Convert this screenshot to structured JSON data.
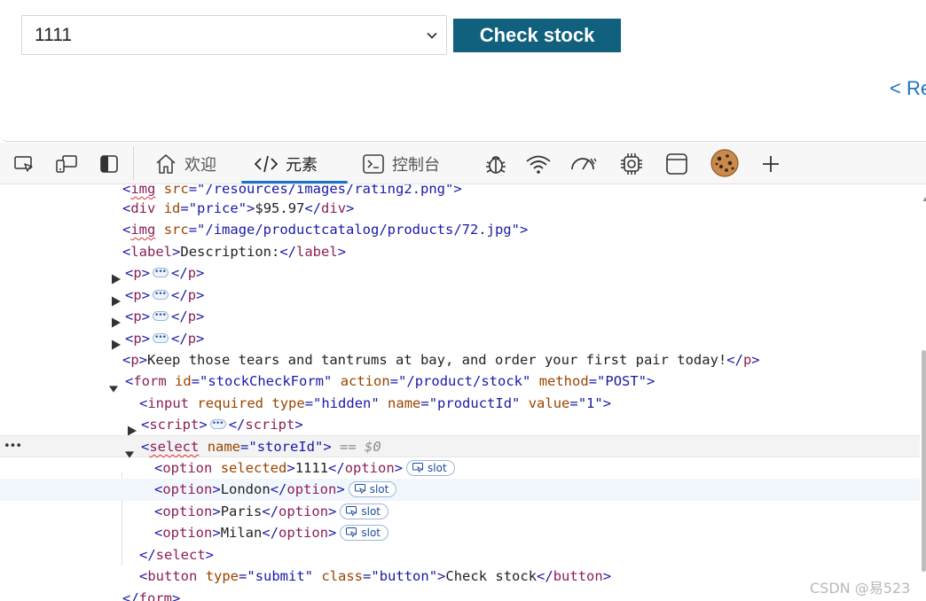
{
  "page": {
    "store_select_value": "1111",
    "check_stock_label": "Check stock",
    "return_link": "< Re"
  },
  "devtools": {
    "tabs": [
      {
        "label": "欢迎",
        "icon": "home-icon"
      },
      {
        "label": "元素",
        "icon": "code-icon"
      },
      {
        "label": "控制台",
        "icon": "console-icon"
      }
    ],
    "accent_color": "#1a73c8",
    "toolbar_icons": [
      "inspect-icon",
      "device-emulation-icon",
      "sidebar-toggle-icon",
      "bug-icon",
      "wifi-icon",
      "performance-gauge-icon",
      "cpu-icon",
      "application-window-icon",
      "cookie-icon",
      "plus-icon"
    ]
  },
  "tree": {
    "r0_attr": "src",
    "r0_val": "\"/resources/images/rating2.png\"",
    "r1_attr": "id",
    "r1_val": "\"price\"",
    "r1_text": "$95.97",
    "r2_attr": "src",
    "r2_val": "\"/image/productcatalog/products/72.jpg\"",
    "r3_text": "Description:",
    "r8_text": "Keep those tears and tantrums at bay, and order your first pair today!",
    "r9_a1": "id",
    "r9_v1": "\"stockCheckForm\"",
    "r9_a2": "action",
    "r9_v2": "\"/product/stock\"",
    "r9_a3": "method",
    "r9_v3": "\"POST\"",
    "r10_a1": "required",
    "r10_a2": "type",
    "r10_v2": "\"hidden\"",
    "r10_a3": "name",
    "r10_v3": "\"productId\"",
    "r10_a4": "value",
    "r10_v4": "\"1\"",
    "r12_attr": "name",
    "r12_val": "\"storeId\"",
    "r12_comment": "== $0",
    "options": [
      "1111",
      "London",
      "Paris",
      "Milan"
    ],
    "option_selected_attr": "selected",
    "slot_label": "slot",
    "r18_a1": "type",
    "r18_v1": "\"submit\"",
    "r18_a2": "class",
    "r18_v2": "\"button\"",
    "r18_text": "Check stock"
  },
  "watermark": "CSDN @易523"
}
